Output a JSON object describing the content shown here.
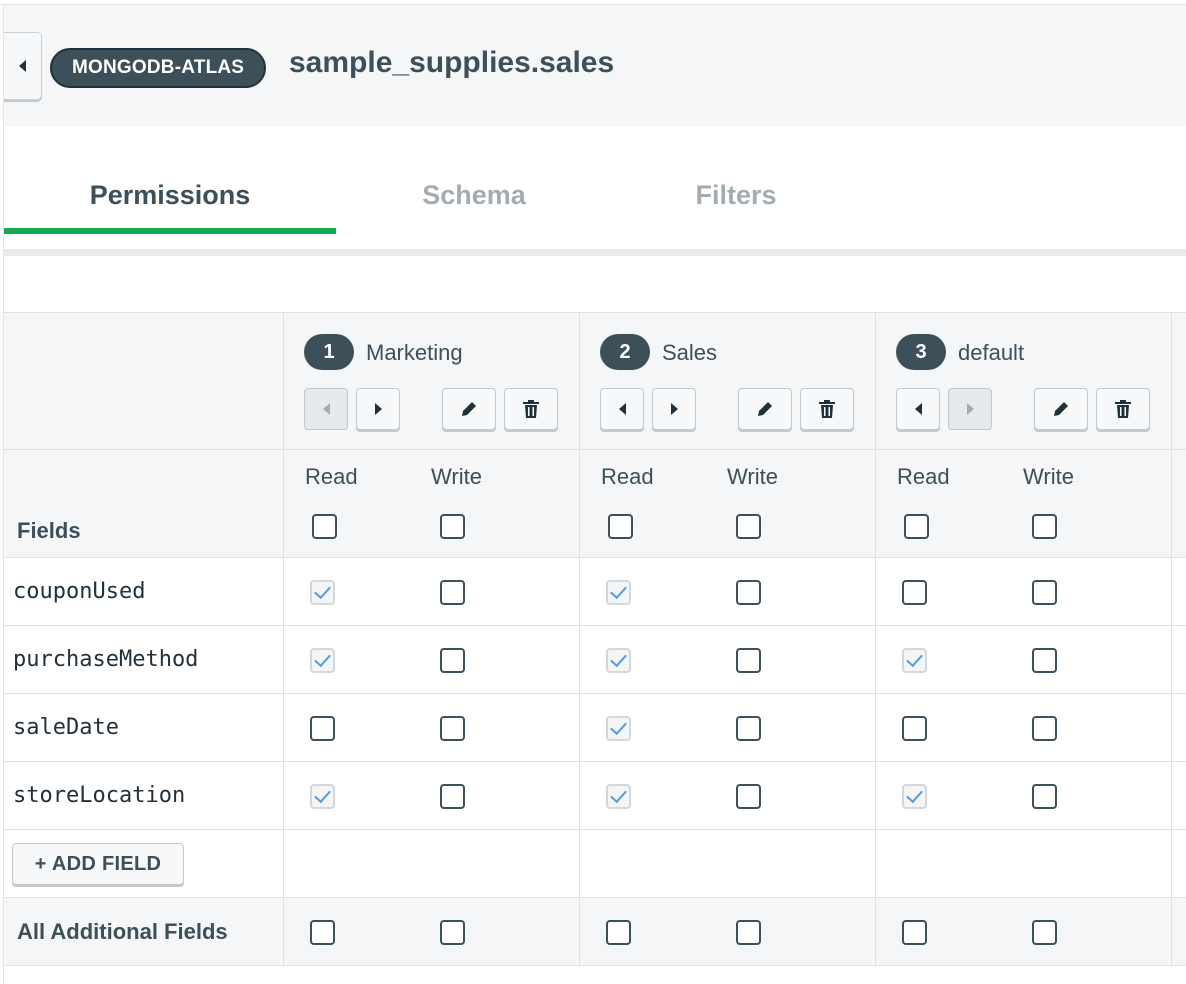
{
  "header": {
    "service_badge": "MONGODB-ATLAS",
    "collection_title": "sample_supplies.sales"
  },
  "tabs": [
    {
      "label": "Permissions",
      "active": true
    },
    {
      "label": "Schema",
      "active": false
    },
    {
      "label": "Filters",
      "active": false
    }
  ],
  "roles": [
    {
      "number": "1",
      "name": "Marketing"
    },
    {
      "number": "2",
      "name": "Sales"
    },
    {
      "number": "3",
      "name": "default"
    }
  ],
  "table": {
    "fields_label": "Fields",
    "read_label": "Read",
    "write_label": "Write",
    "rows": [
      {
        "field": "couponUsed",
        "perms": [
          [
            true,
            false
          ],
          [
            true,
            false
          ],
          [
            false,
            false
          ]
        ]
      },
      {
        "field": "purchaseMethod",
        "perms": [
          [
            true,
            false
          ],
          [
            true,
            false
          ],
          [
            true,
            false
          ]
        ]
      },
      {
        "field": "saleDate",
        "perms": [
          [
            false,
            false
          ],
          [
            true,
            false
          ],
          [
            false,
            false
          ]
        ]
      },
      {
        "field": "storeLocation",
        "perms": [
          [
            true,
            false
          ],
          [
            true,
            false
          ],
          [
            true,
            false
          ]
        ]
      }
    ],
    "add_field_label": "+ ADD FIELD",
    "additional_fields_label": "All Additional Fields"
  },
  "colors": {
    "accent_green": "#13aa52",
    "badge_dark": "#3d4f58",
    "check_blue": "#5b9ad6"
  }
}
